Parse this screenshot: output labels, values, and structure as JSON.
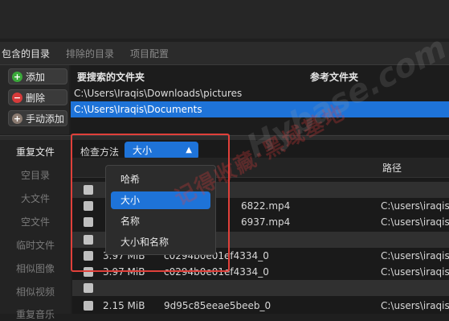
{
  "tabs": [
    "包含的目录",
    "排除的目录",
    "项目配置"
  ],
  "dir_buttons": {
    "add": "添加",
    "delete": "删除",
    "manual_add": "手动添加"
  },
  "dir_table": {
    "col_search": "要搜索的文件夹",
    "col_ref": "参考文件夹",
    "rows": [
      "C:\\Users\\Iraqis\\Downloads\\pictures",
      "C:\\Users\\Iraqis\\Documents"
    ]
  },
  "sidebar": [
    "重复文件",
    "空目录",
    "大文件",
    "空文件",
    "临时文件",
    "相似图像",
    "相似视频",
    "重复音乐"
  ],
  "check_method": {
    "label": "检查方法",
    "selected": "大小",
    "options": [
      "哈希",
      "大小",
      "名称",
      "大小和名称"
    ]
  },
  "results": {
    "col_path": "路径",
    "rows": [
      {
        "size": "",
        "name": "",
        "path": "",
        "group": true
      },
      {
        "size": "",
        "name": "6822.mp4",
        "path": "C:\\users\\iraqis",
        "group": false
      },
      {
        "size": "",
        "name": "6937.mp4",
        "path": "C:\\users\\iraqis",
        "group": false
      },
      {
        "size": "",
        "name": "",
        "path": "",
        "group": true
      },
      {
        "size": "3.97 MiB",
        "name": "c0294b0e01ef4334_0",
        "path": "C:\\users\\iraqis",
        "group": false
      },
      {
        "size": "3.97 MiB",
        "name": "c0294b0e01ef4334_0",
        "path": "C:\\users\\iraqis",
        "group": false
      },
      {
        "size": "",
        "name": "",
        "path": "",
        "group": true
      },
      {
        "size": "2.15 MiB",
        "name": "9d95c85eeae5beeb_0",
        "path": "C:\\users\\iraqis",
        "group": false
      }
    ]
  },
  "watermark": {
    "text1": "记得收藏·黑域基地",
    "text2": "Hybase.com"
  },
  "colors": {
    "accent": "#1e73d8",
    "highlight": "#e0403a"
  }
}
